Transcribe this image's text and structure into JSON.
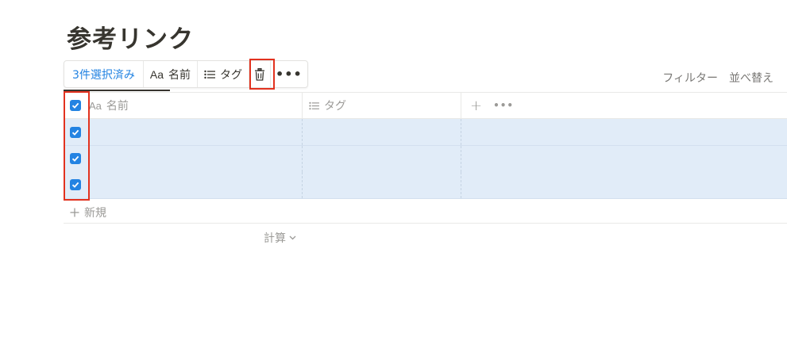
{
  "page": {
    "title": "参考リンク"
  },
  "toolbar": {
    "selected_count": "3件選択済み",
    "name_prefix": "Aa",
    "name_label": "名前",
    "tag_label": "タグ",
    "more_label": "•••"
  },
  "view_actions": {
    "filter": "フィルター",
    "sort": "並べ替え"
  },
  "table": {
    "columns": [
      {
        "prefix": "Aa",
        "label": "名前"
      },
      {
        "label": "タグ"
      }
    ],
    "add_column": "+",
    "more": "•••",
    "rows": [
      {
        "name": "",
        "tags": "",
        "checked": true
      },
      {
        "name": "",
        "tags": "",
        "checked": true
      },
      {
        "name": "",
        "tags": "",
        "checked": true
      }
    ],
    "new_row_label": "新規",
    "calc_label": "計算"
  },
  "colors": {
    "accent": "#2383e2",
    "selected_row": "#e1ecf8",
    "highlight": "#e2321f"
  },
  "icons": [
    "trash-icon",
    "list-icon",
    "plus-icon",
    "chevron-down-icon",
    "check-icon",
    "more-icon"
  ]
}
